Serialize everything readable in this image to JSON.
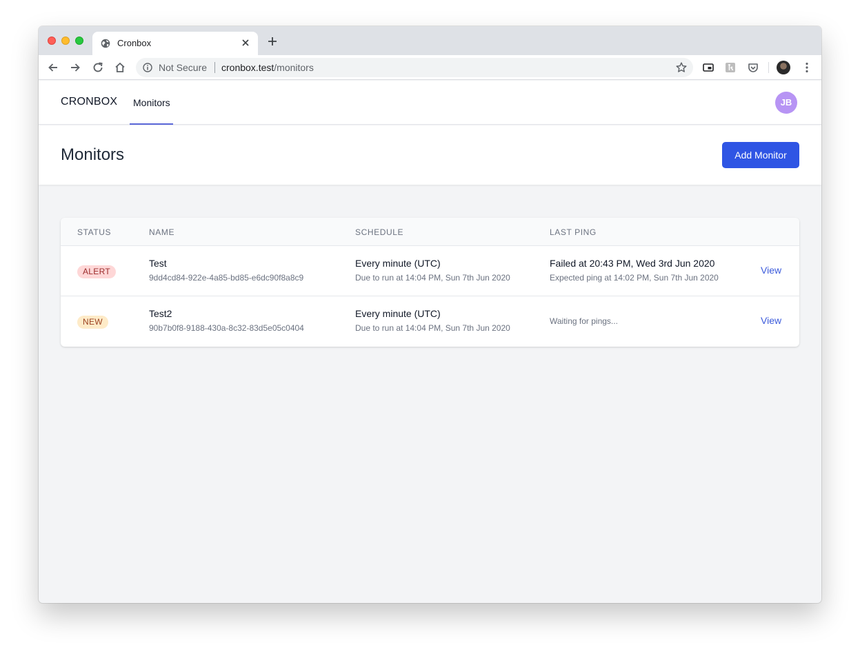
{
  "browser": {
    "tab_title": "Cronbox",
    "security_label": "Not Secure",
    "url_host": "cronbox.test",
    "url_path": "/monitors"
  },
  "nav": {
    "brand": "CRONBOX",
    "links": [
      {
        "label": "Monitors"
      }
    ],
    "avatar_initials": "JB",
    "avatar_color": "#b794f4",
    "active_color": "#5a67d8"
  },
  "header": {
    "title": "Monitors",
    "add_button_label": "Add Monitor",
    "accent_color": "#2f55e4"
  },
  "table": {
    "columns": [
      "STATUS",
      "NAME",
      "SCHEDULE",
      "LAST PING"
    ],
    "rows": [
      {
        "status": "ALERT",
        "status_color": "#fed7d7",
        "name": "Test",
        "id": "9dd4cd84-922e-4a85-bd85-e6dc90f8a8c9",
        "schedule": "Every minute (UTC)",
        "due": "Due to run at 14:04 PM, Sun 7th Jun 2020",
        "last_ping": "Failed at 20:43 PM, Wed 3rd Jun 2020",
        "expected": "Expected ping at 14:02 PM, Sun 7th Jun 2020",
        "action": "View"
      },
      {
        "status": "NEW",
        "status_color": "#feebc8",
        "name": "Test2",
        "id": "90b7b0f8-9188-430a-8c32-83d5e05c0404",
        "schedule": "Every minute (UTC)",
        "due": "Due to run at 14:04 PM, Sun 7th Jun 2020",
        "last_ping": "Waiting for pings...",
        "action": "View"
      }
    ]
  }
}
